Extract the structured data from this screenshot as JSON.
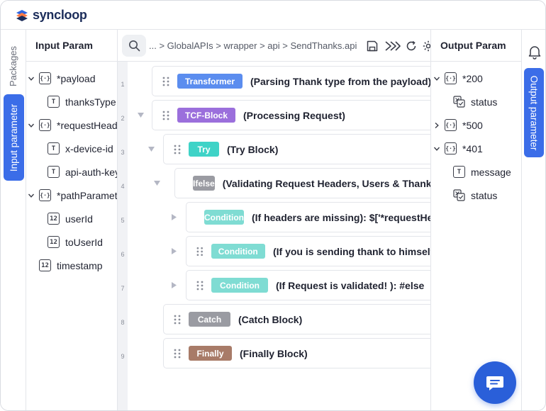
{
  "app": {
    "brand": "syncloop"
  },
  "left_rail": {
    "packages_tab": "Packages",
    "input_tab": "Input parameter"
  },
  "input_panel": {
    "title": "Input Param",
    "items": [
      {
        "label": "*payload",
        "type": "object",
        "expanded": true
      },
      {
        "label": "thanksType",
        "type": "text"
      },
      {
        "label": "*requestHeaders",
        "type": "object",
        "expanded": true
      },
      {
        "label": "x-device-id",
        "type": "text"
      },
      {
        "label": "api-auth-key",
        "type": "text"
      },
      {
        "label": "*pathParameters",
        "type": "object",
        "expanded": true
      },
      {
        "label": "userId",
        "type": "number"
      },
      {
        "label": "toUserId",
        "type": "number"
      },
      {
        "label": "timestamp",
        "type": "number"
      }
    ]
  },
  "toolbar": {
    "breadcrumb": "... > GlobalAPIs > wrapper > api > SendThanks.api",
    "icons": [
      "save-icon",
      "run-icon",
      "refresh-icon",
      "settings-icon"
    ]
  },
  "editor": {
    "line_numbers": [
      "1",
      "2",
      "3",
      "4",
      "5",
      "6",
      "7",
      "8",
      "9"
    ],
    "steps": [
      {
        "chip": "Transformer",
        "label": "(Parsing Thank type from the payload)",
        "color": "#5b8def"
      },
      {
        "chip": "TCF-Block",
        "label": "(Processing Request)",
        "color": "#9b6fdc"
      },
      {
        "chip": "Try",
        "label": "(Try Block)",
        "color": "#3fd3c7"
      },
      {
        "chip": "Ifelse",
        "label": "(Validating Request Headers, Users & Thank type)",
        "color": "#9a9ba2"
      },
      {
        "chip": "Condition",
        "label": "(If headers are missing): $['*requestHeaders']",
        "color": "#7fdcd3"
      },
      {
        "chip": "Condition",
        "label": "(If you is sending thank to himself...",
        "color": "#7fdcd3"
      },
      {
        "chip": "Condition",
        "label": "(If Request is validated! ): #else",
        "color": "#7fdcd3"
      },
      {
        "chip": "Catch",
        "label": "(Catch Block)",
        "color": "#9a9ba2"
      },
      {
        "chip": "Finally",
        "label": "(Finally Block)",
        "color": "#a87b68"
      }
    ]
  },
  "output_panel": {
    "title": "Output Param",
    "items": [
      {
        "label": "*200",
        "type": "object",
        "expanded": true
      },
      {
        "label": "status",
        "type": "status"
      },
      {
        "label": "*500",
        "type": "object",
        "expanded": false
      },
      {
        "label": "*401",
        "type": "object",
        "expanded": true
      },
      {
        "label": "message",
        "type": "text"
      },
      {
        "label": "status",
        "type": "status"
      }
    ]
  },
  "right_rail": {
    "output_tab": "Output parameter"
  }
}
